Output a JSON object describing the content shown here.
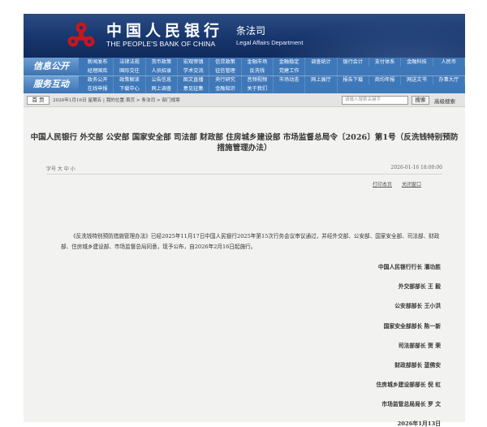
{
  "header": {
    "bank_name_cn": "中国人民银行",
    "bank_name_en": "THE PEOPLE'S BANK OF CHINA",
    "dept_cn": "条法司",
    "dept_en": "Legal Affairs Department"
  },
  "nav": {
    "group1_label": "信息公开",
    "group2_label": "服务互动",
    "row1": [
      "新闻发布",
      "法律法规",
      "货币政策",
      "宏观审慎",
      "信贷政策",
      "金融市场",
      "金融稳定",
      "调查统计",
      "银行会计",
      "支付体系",
      "金融科技",
      "人民币",
      "经理国库",
      "国际交往",
      "人员招录",
      "学术交流",
      "征信管理",
      "反洗钱",
      "党建工作",
      ""
    ],
    "row2": [
      "政务公开",
      "政策解读",
      "公告信息",
      "图文直播",
      "央行研究",
      "音频视频",
      "市场动态",
      "网上展厅",
      "报告下载",
      "商均年报",
      "网送文书",
      "办事大厅",
      "在线申报",
      "下载中心",
      "网上调查",
      "意见征集",
      "金融知识",
      "关于我们",
      "",
      ""
    ]
  },
  "breadcrumb": {
    "home_label": "首 页",
    "path_text": "2026年1月16日 星期五 | 我的位置:首页 > 条法司 > 部门规章",
    "search_placeholder": "请输入搜索关键字",
    "search_button": "搜索",
    "advanced_search": "高级搜索"
  },
  "article": {
    "title": "中国人民银行 外交部 公安部 国家安全部 司法部 财政部 住房城乡建设部 市场监督总局令〔2026〕第1号（反洗钱特别预防措施管理办法）",
    "font_size_label": "字号 大 中 小",
    "date": "2026-01-16 18:00:00",
    "print_label": "打印本页",
    "close_label": "关闭窗口",
    "body": "《反洗钱特别预防措施管理办法》已经2025年11月17日中国人民银行2025年第15次行务会议审议通过，并经外交部、公安部、国家安全部、司法部、财政部、住房城乡建设部、市场监督总局同意，现予公布，自2026年2月16日起施行。",
    "signatures": [
      "中国人民银行行长  潘功胜",
      "外交部部长  王 毅",
      "公安部部长  王小洪",
      "国家安全部部长  陈一新",
      "司法部部长  贺 荣",
      "财政部部长  蓝佛安",
      "住房城乡建设部部长  倪 虹",
      "市场监管总局局长  罗 文",
      "2026年1月13日"
    ]
  },
  "colors": {
    "header_bg": "#17366d",
    "nav_bg": "#3f78b8",
    "logo_red": "#c8161d"
  }
}
